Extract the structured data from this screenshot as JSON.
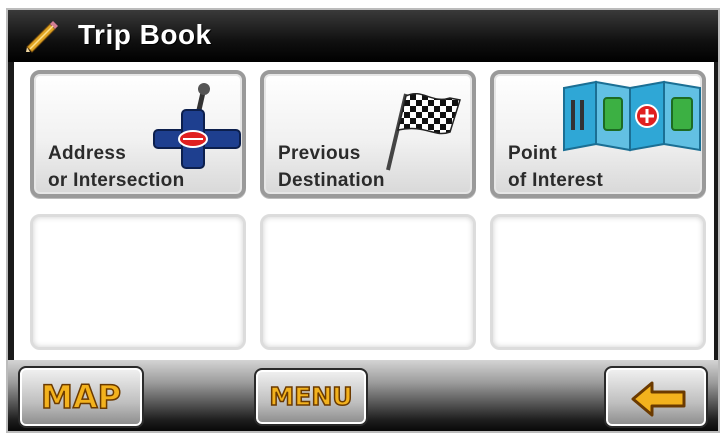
{
  "header": {
    "title": "Trip Book",
    "icon": "pencil-icon"
  },
  "tiles": [
    {
      "line1": "Address",
      "line2": "or Intersection",
      "icon": "intersection-sign-icon"
    },
    {
      "line1": "Previous",
      "line2": "Destination",
      "icon": "checkered-flag-icon"
    },
    {
      "line1": "Point",
      "line2": "of Interest",
      "icon": "poi-map-icon"
    }
  ],
  "footer": {
    "map_label": "MAP",
    "menu_label": "MENU",
    "back_icon": "back-arrow-icon"
  },
  "colors": {
    "button_text": "#f3b21d",
    "title_bar": "#101010",
    "accent_red": "#e02020",
    "accent_blue": "#1e4fa6"
  }
}
